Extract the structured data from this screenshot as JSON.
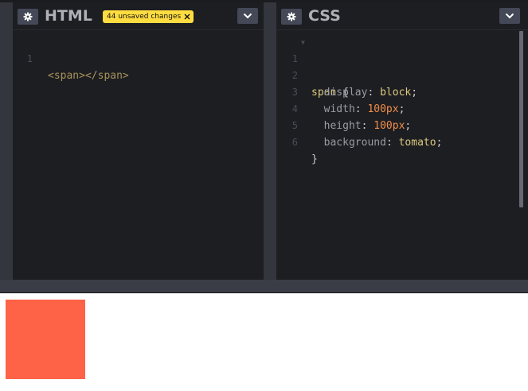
{
  "html_panel": {
    "title": "HTML",
    "badge": "44 unsaved changes",
    "lines": [
      {
        "number": "1",
        "code": "<span></span>"
      }
    ]
  },
  "css_panel": {
    "title": "CSS",
    "lines": [
      {
        "number": "1",
        "selector": "span",
        "brace": " {"
      },
      {
        "number": "2",
        "property": "display",
        "value": "block"
      },
      {
        "number": "3",
        "property": "width",
        "value": "100px"
      },
      {
        "number": "4",
        "property": "height",
        "value": "100px"
      },
      {
        "number": "5",
        "property": "background",
        "value": "tomato"
      },
      {
        "number": "6",
        "brace": "}"
      }
    ]
  },
  "icons": {
    "settings": "gear-icon",
    "collapse": "chevron-down-icon",
    "close": "close-icon"
  },
  "colors": {
    "result_box": "#ff6347",
    "badge": "#ffdd40",
    "panel_bg": "#1d1e22"
  }
}
